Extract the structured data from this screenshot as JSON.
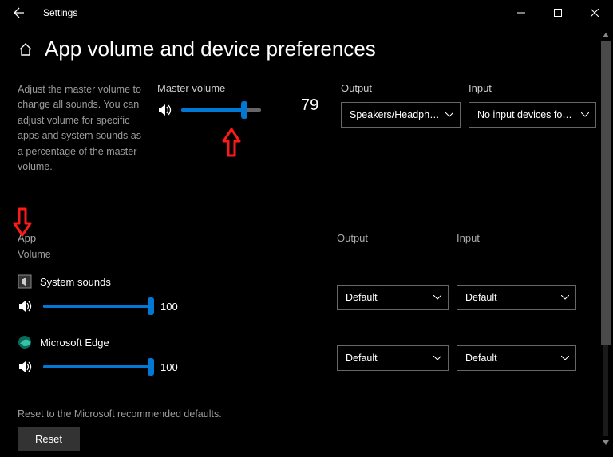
{
  "window": {
    "title": "Settings"
  },
  "page": {
    "title": "App volume and device preferences",
    "description": "Adjust the master volume to change all sounds. You can adjust volume for specific apps and system sounds as a percentage of the master volume."
  },
  "master": {
    "label": "Master volume",
    "value": "79",
    "percent": 79
  },
  "output": {
    "label": "Output",
    "selected": "Speakers/Headphon…"
  },
  "input": {
    "label": "Input",
    "selected": "No input devices fo…"
  },
  "columns": {
    "app": "App",
    "volume": "Volume",
    "output": "Output",
    "input": "Input"
  },
  "apps": [
    {
      "name": "System sounds",
      "volume": "100",
      "output": "Default",
      "input": "Default",
      "icon": "system-sounds"
    },
    {
      "name": "Microsoft Edge",
      "volume": "100",
      "output": "Default",
      "input": "Default",
      "icon": "edge"
    }
  ],
  "reset": {
    "description": "Reset to the Microsoft recommended defaults.",
    "button": "Reset"
  },
  "annotations": {
    "arrow_up": {
      "color": "#ff1a1a"
    },
    "arrow_down": {
      "color": "#ff1a1a"
    }
  }
}
